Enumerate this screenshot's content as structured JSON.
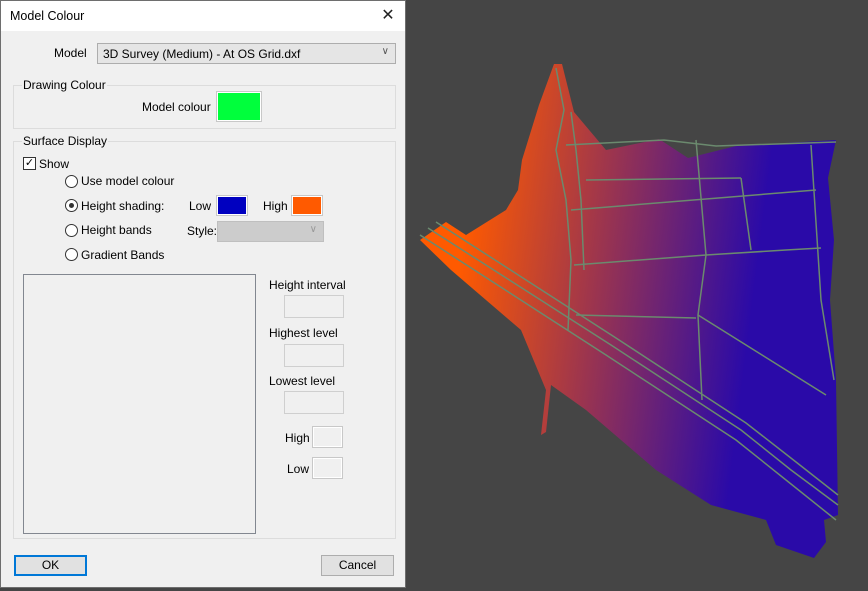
{
  "dialog": {
    "title": "Model Colour",
    "close_label": "✕",
    "model": {
      "label": "Model",
      "selected": "3D Survey (Medium) - At OS Grid.dxf"
    },
    "drawing_colour": {
      "group_label": "Drawing Colour",
      "model_colour_label": "Model colour",
      "model_colour": "#00ff3c"
    },
    "surface_display": {
      "group_label": "Surface Display",
      "show_label": "Show",
      "show_checked": true,
      "options": [
        {
          "label": "Use model colour",
          "selected": false
        },
        {
          "label": "Height shading:",
          "selected": true
        },
        {
          "label": "Height bands",
          "selected": false
        },
        {
          "label": "Gradient Bands",
          "selected": false
        }
      ],
      "low_label": "Low",
      "low_colour": "#0000c0",
      "high_label": "High",
      "high_colour": "#ff5a00",
      "style_label": "Style:",
      "style_value": "",
      "height_interval_label": "Height interval",
      "height_interval_value": "",
      "highest_level_label": "Highest level",
      "highest_level_value": "",
      "lowest_level_label": "Lowest level",
      "lowest_level_value": "",
      "band_high_label": "High",
      "band_low_label": "Low"
    },
    "ok_label": "OK",
    "cancel_label": "Cancel"
  },
  "viewport": {
    "gradient_high": "#ff5a00",
    "gradient_low": "#2a0aa8",
    "linework_colour": "#6b8a6e",
    "background": "#454545"
  }
}
